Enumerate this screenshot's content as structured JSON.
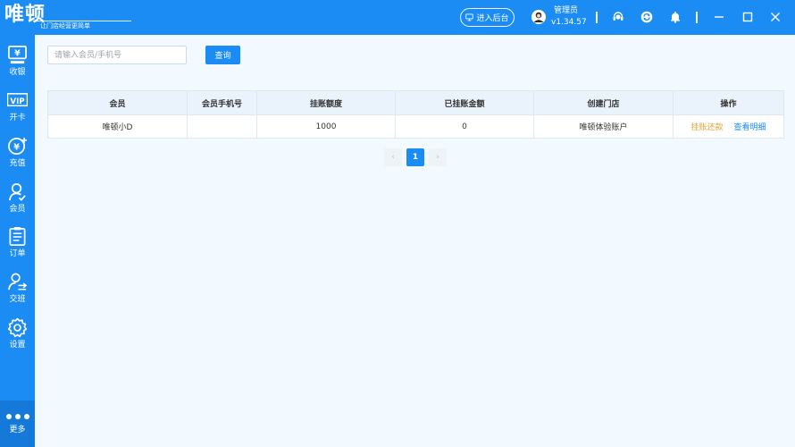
{
  "brand": {
    "name": "唯顿",
    "slogan": "让门店经营更简单"
  },
  "header": {
    "backend_label": "进入后台",
    "user_name": "管理员",
    "version": "v1.34.57"
  },
  "sidebar": {
    "items": [
      {
        "label": "收银",
        "icon": "cashier-icon"
      },
      {
        "label": "开卡",
        "icon": "vip-card-icon"
      },
      {
        "label": "充值",
        "icon": "recharge-icon"
      },
      {
        "label": "会员",
        "icon": "member-icon"
      },
      {
        "label": "订单",
        "icon": "order-icon"
      },
      {
        "label": "交班",
        "icon": "shift-handover-icon"
      },
      {
        "label": "设置",
        "icon": "settings-icon"
      }
    ],
    "more_label": "更多"
  },
  "search": {
    "placeholder": "请输入会员/手机号",
    "value": "",
    "button_label": "查询"
  },
  "table": {
    "columns": [
      "会员",
      "会员手机号",
      "挂账额度",
      "已挂账金额",
      "创建门店",
      "操作"
    ],
    "rows": [
      {
        "member": "唯顿小D",
        "phone": "",
        "credit_limit": "1000",
        "credited_amount": "0",
        "store": "唯顿体验账户",
        "action_repay": "挂账还款",
        "action_detail": "查看明细"
      }
    ]
  },
  "pagination": {
    "prev": "‹",
    "current": "1",
    "next": "›"
  },
  "colors": {
    "primary": "#1a8cf3",
    "warning": "#e6a23c",
    "background": "#f2f9ff"
  }
}
